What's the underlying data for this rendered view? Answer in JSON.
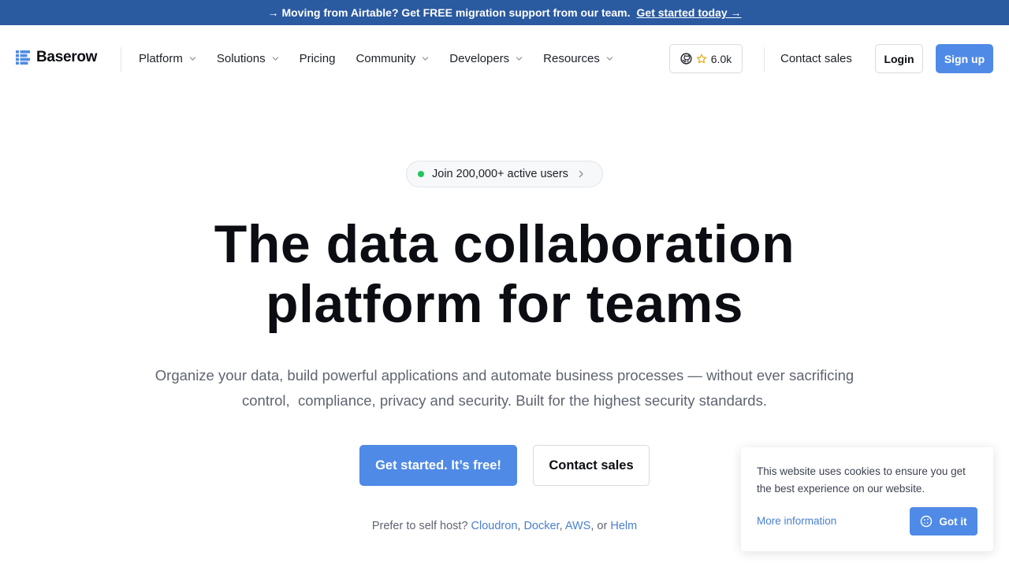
{
  "announcement": {
    "arrow": "→",
    "text": "Moving from Airtable? Get FREE migration support from our team.",
    "cta": "Get started today →"
  },
  "brand": {
    "name": "Baserow",
    "accent": "#4f8ae6",
    "bar": "#2a5aa0"
  },
  "nav": {
    "items": [
      {
        "label": "Platform",
        "dropdown": true
      },
      {
        "label": "Solutions",
        "dropdown": true
      },
      {
        "label": "Pricing",
        "dropdown": false
      },
      {
        "label": "Community",
        "dropdown": true
      },
      {
        "label": "Developers",
        "dropdown": true
      },
      {
        "label": "Resources",
        "dropdown": true
      }
    ],
    "github_stars": "6.0k",
    "contact": "Contact sales",
    "login": "Login",
    "signup": "Sign up"
  },
  "hero": {
    "pill": "Join 200,000+ active users",
    "headline_line1": "The data collaboration",
    "headline_line2": "platform for teams",
    "subtitle_line1": "Organize your data, build powerful applications and automate business processes — without ever sacrificing",
    "subtitle_line2": "control,  compliance, privacy and security. Built for the highest security standards.",
    "primary_cta": "Get started. It’s free!",
    "secondary_cta": "Contact sales",
    "selfhost_prefix": "Prefer to self host?",
    "selfhost_links": [
      "Cloudron",
      "Docker",
      "AWS",
      "Helm"
    ],
    "selfhost_or": ", or"
  },
  "cookie": {
    "text": "This website uses cookies to ensure you get the best experience on our website.",
    "more": "More information",
    "accept": "Got it"
  }
}
